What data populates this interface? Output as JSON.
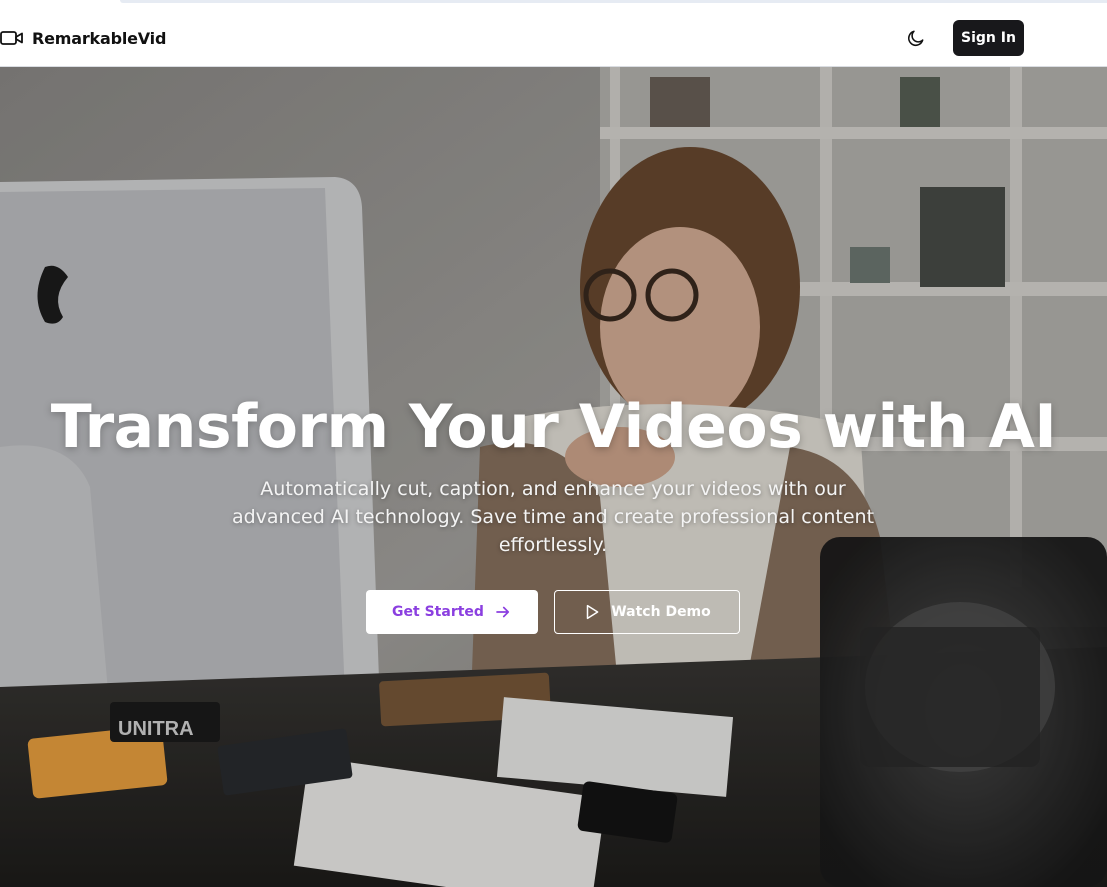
{
  "header": {
    "brand_name": "RemarkableVid",
    "brand_icon": "video-camera-icon",
    "theme_toggle_icon": "moon-icon",
    "sign_in_label": "Sign In"
  },
  "hero": {
    "headline": "Transform Your Videos with AI",
    "subheadline": "Automatically cut, caption, and enhance your videos with our advanced AI technology. Save time and create professional content effortlessly.",
    "primary_cta": {
      "label": "Get Started",
      "icon": "arrow-right-icon"
    },
    "secondary_cta": {
      "label": "Watch Demo",
      "icon": "play-icon"
    },
    "background_image_logo_text": "UNITRA"
  },
  "colors": {
    "accent": "#8b3fe0",
    "sign_in_bg": "#18181b",
    "header_bg": "#ffffff"
  }
}
